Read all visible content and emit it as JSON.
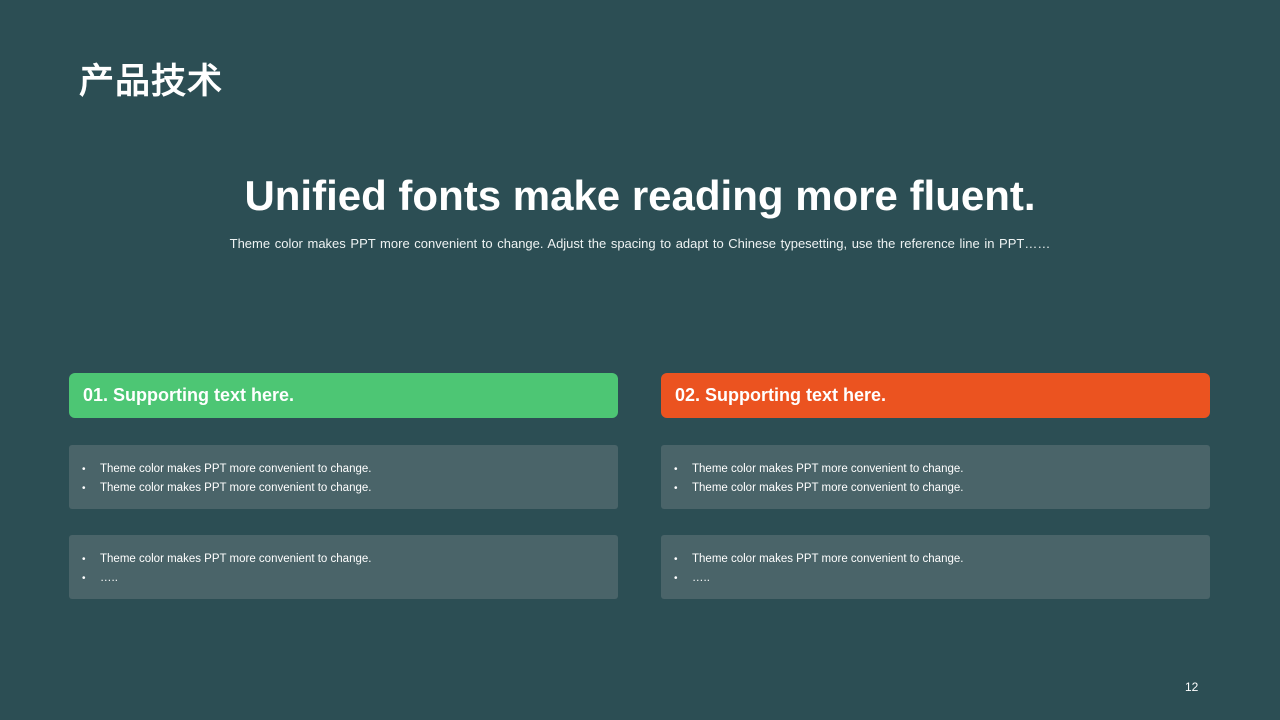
{
  "slide": {
    "section_title": "产品技术",
    "headline": "Unified fonts make reading more fluent.",
    "subtitle": "Theme color makes PPT more convenient to change. Adjust the spacing to adapt to Chinese typesetting, use the reference line in PPT……",
    "page_number": "12"
  },
  "columns": [
    {
      "header": "01. Supporting text here.",
      "accent_color": "#4dc674",
      "cards": [
        {
          "items": [
            "Theme color makes PPT more convenient to change.",
            "Theme color makes PPT more convenient to change."
          ]
        },
        {
          "items": [
            "Theme color makes PPT more convenient to change.",
            "….."
          ]
        }
      ]
    },
    {
      "header": "02. Supporting text here.",
      "accent_color": "#eb5320",
      "cards": [
        {
          "items": [
            "Theme color makes PPT more convenient to change.",
            "Theme color makes PPT more convenient to change."
          ]
        },
        {
          "items": [
            "Theme color makes PPT more convenient to change.",
            "….."
          ]
        }
      ]
    }
  ],
  "theme": {
    "background": "#2c4e54",
    "card_background": "#4a6469",
    "text": "#ffffff"
  },
  "bullet_glyph": "•"
}
